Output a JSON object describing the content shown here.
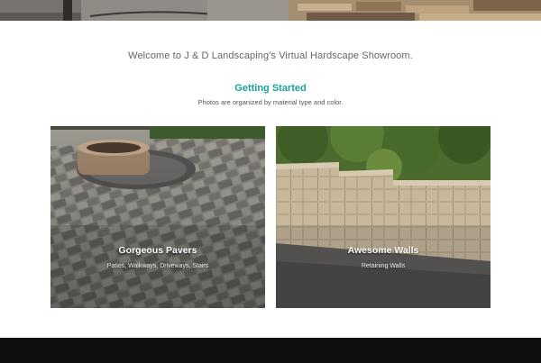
{
  "header": {
    "banner_image": "hardscape-stone-banner"
  },
  "intro": {
    "welcome_text": "Welcome to J & D Landscaping's Virtual Hardscape Showroom."
  },
  "section": {
    "title": "Getting Started",
    "subtitle": "Photos are organized by material type and color.",
    "accent_color": "#1aa39a"
  },
  "cards": [
    {
      "title": "Gorgeous Pavers",
      "subtitle": "Patios, Walkways, Driveways, Stairs",
      "image": "paver-patio-with-fire-pit"
    },
    {
      "title": "Awesome Walls",
      "subtitle": "Retaining Walls",
      "image": "block-retaining-wall"
    }
  ],
  "footer": {
    "background": "#0e0e0e"
  }
}
